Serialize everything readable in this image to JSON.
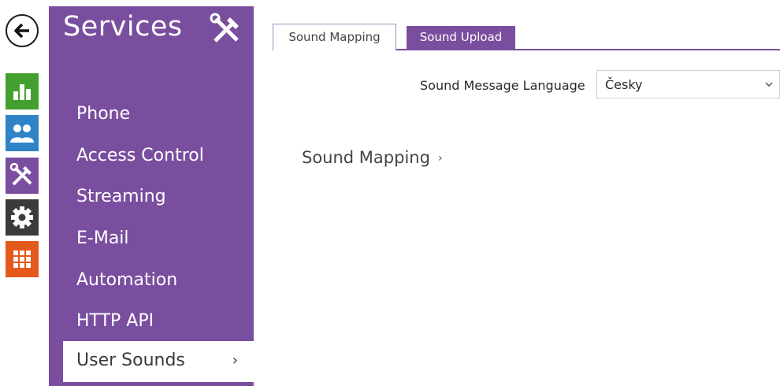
{
  "sidebar": {
    "title": "Services",
    "items": [
      {
        "label": "Phone"
      },
      {
        "label": "Access Control"
      },
      {
        "label": "Streaming"
      },
      {
        "label": "E-Mail"
      },
      {
        "label": "Automation"
      },
      {
        "label": "HTTP API"
      },
      {
        "label": "User Sounds",
        "active": true,
        "chevron": "›"
      }
    ]
  },
  "rail": {
    "icons": [
      "back-arrow-icon",
      "status-chart-icon",
      "users-icon",
      "services-tools-icon",
      "settings-gear-icon",
      "apps-grid-icon"
    ],
    "colors": {
      "status": "#43a02f",
      "users": "#2f84c8",
      "services": "#7a4e9f",
      "settings": "#3b3b3b",
      "apps": "#e4591c"
    }
  },
  "tabs": [
    {
      "label": "Sound Mapping",
      "active": true
    },
    {
      "label": "Sound Upload",
      "active": false
    }
  ],
  "language": {
    "label": "Sound Message Language",
    "value": "Česky"
  },
  "section": {
    "title": "Sound Mapping",
    "chevron": "›"
  },
  "colors": {
    "accent": "#7a4e9f"
  }
}
